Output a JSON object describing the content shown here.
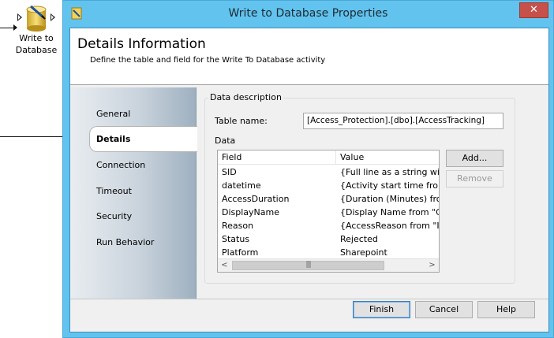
{
  "canvas": {
    "activity_label_line1": "Write to",
    "activity_label_line2": "Database"
  },
  "dialog": {
    "title": "Write to Database Properties",
    "close_symbol": "✕",
    "header": {
      "title": "Details Information",
      "subtitle": "Define the table and field for the Write To Database activity"
    },
    "nav": {
      "items": [
        "General",
        "Details",
        "Connection",
        "Timeout",
        "Security",
        "Run Behavior"
      ],
      "selected": "Details"
    },
    "group_label": "Data description",
    "table_name_label": "Table name:",
    "table_name_value": "[Access_Protection].[dbo].[AccessTracking]",
    "data_label": "Data",
    "list": {
      "columns": [
        "Field",
        "Value"
      ],
      "rows": [
        {
          "field": "SID",
          "value": "{Full line as a string with fi"
        },
        {
          "field": "datetime",
          "value": "{Activity start time from \"."
        },
        {
          "field": "AccessDuration",
          "value": "{Duration (Minutes) from \""
        },
        {
          "field": "DisplayName",
          "value": "{Display Name from \"Get ."
        },
        {
          "field": "Reason",
          "value": "{AccessReason from \"Initi"
        },
        {
          "field": "Status",
          "value": "Rejected"
        },
        {
          "field": "Platform",
          "value": "Sharepoint"
        }
      ],
      "scroll_left": "<",
      "scroll_right": ">",
      "scroll_grip": "|||"
    },
    "buttons": {
      "add": "Add...",
      "remove": "Remove",
      "finish": "Finish",
      "cancel": "Cancel",
      "help": "Help"
    }
  },
  "colors": {
    "titlebar": "#61c3ee",
    "close_button": "#c7504a"
  }
}
